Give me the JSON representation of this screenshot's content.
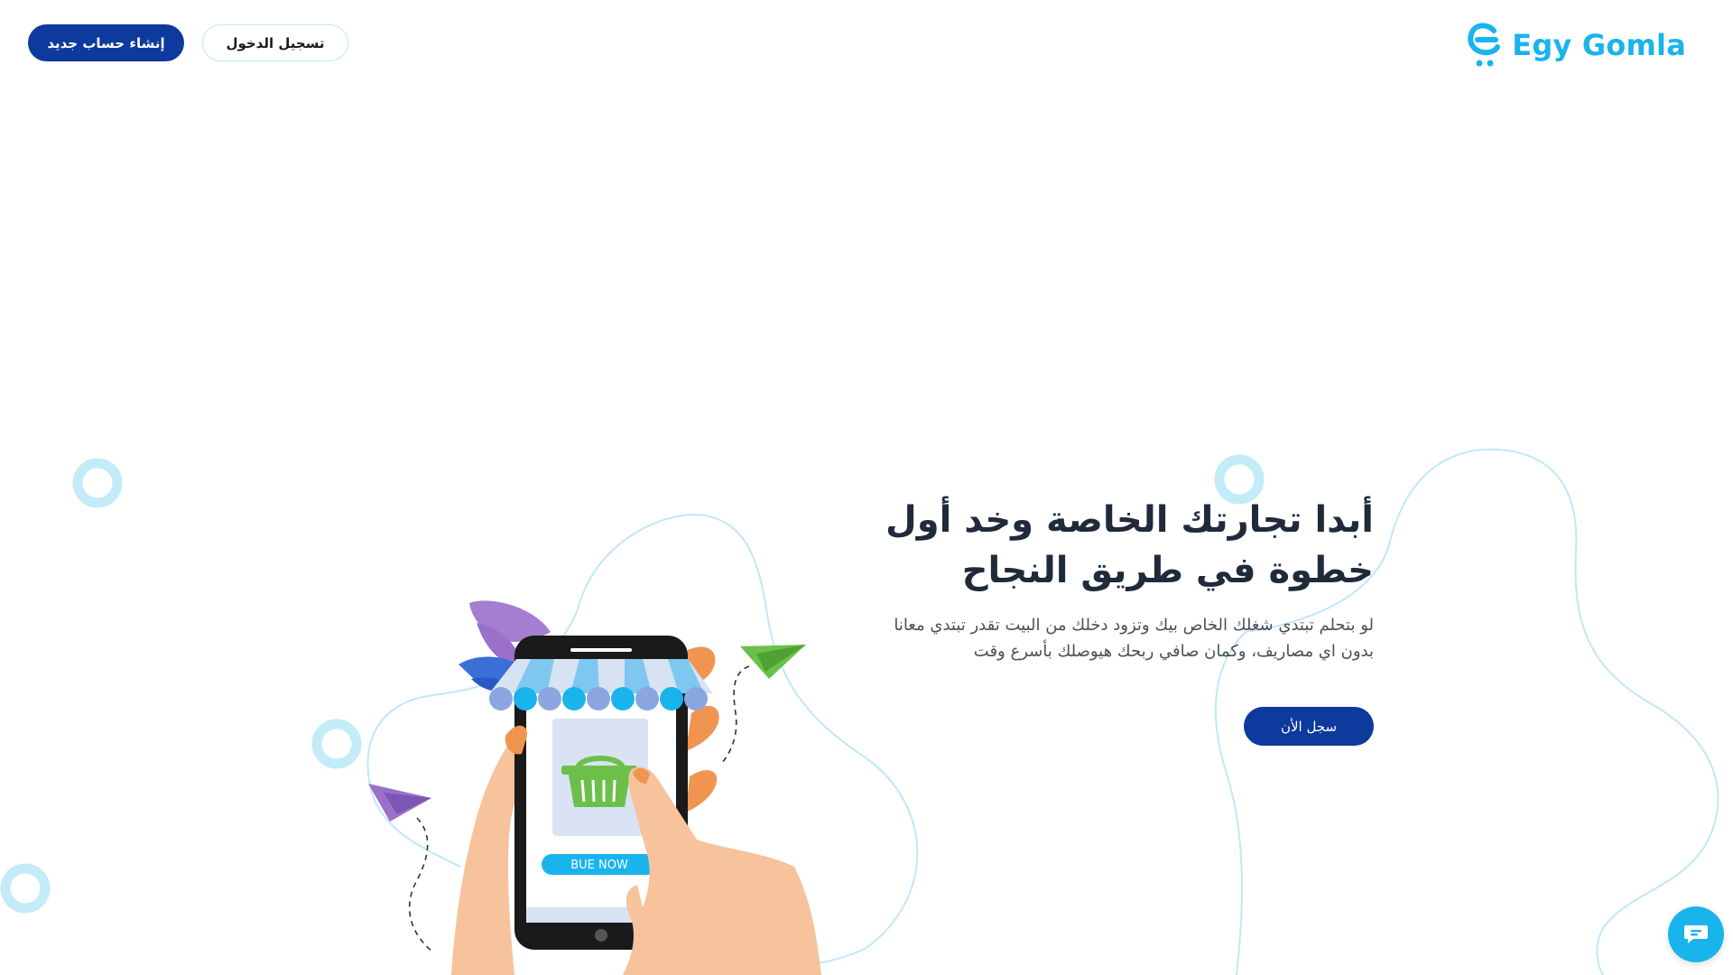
{
  "header": {
    "signup_label": "إنشاء حساب جديد",
    "login_label": "تسجيل الدخول",
    "logo_text": "Egy Gomla",
    "logo_icon": "shopping-cart-e-icon"
  },
  "hero": {
    "title": "أبدا تجارتك الخاصة وخد أول خطوة في طريق النجاح",
    "subtitle": "لو بتحلم تبتدي شغلك الخاص بيك وتزود دخلك من البيت تقدر تبتدي معانا بدون اي مصاريف، وكمان صافي ربحك هيوصلك بأسرع وقت",
    "cta_label": "سجل الأن"
  },
  "illustration": {
    "buy_button_label": "BUE NOW",
    "phone_icon": "smartphone-store-icon",
    "basket_icon": "shopping-basket-icon"
  },
  "chat": {
    "icon": "chat-icon"
  },
  "colors": {
    "primary": "#0d3a9c",
    "accent": "#19b4ec",
    "text_dark": "#1f2a3a",
    "text_muted": "#4a4f58",
    "decor_light": "#bfe8f7"
  }
}
